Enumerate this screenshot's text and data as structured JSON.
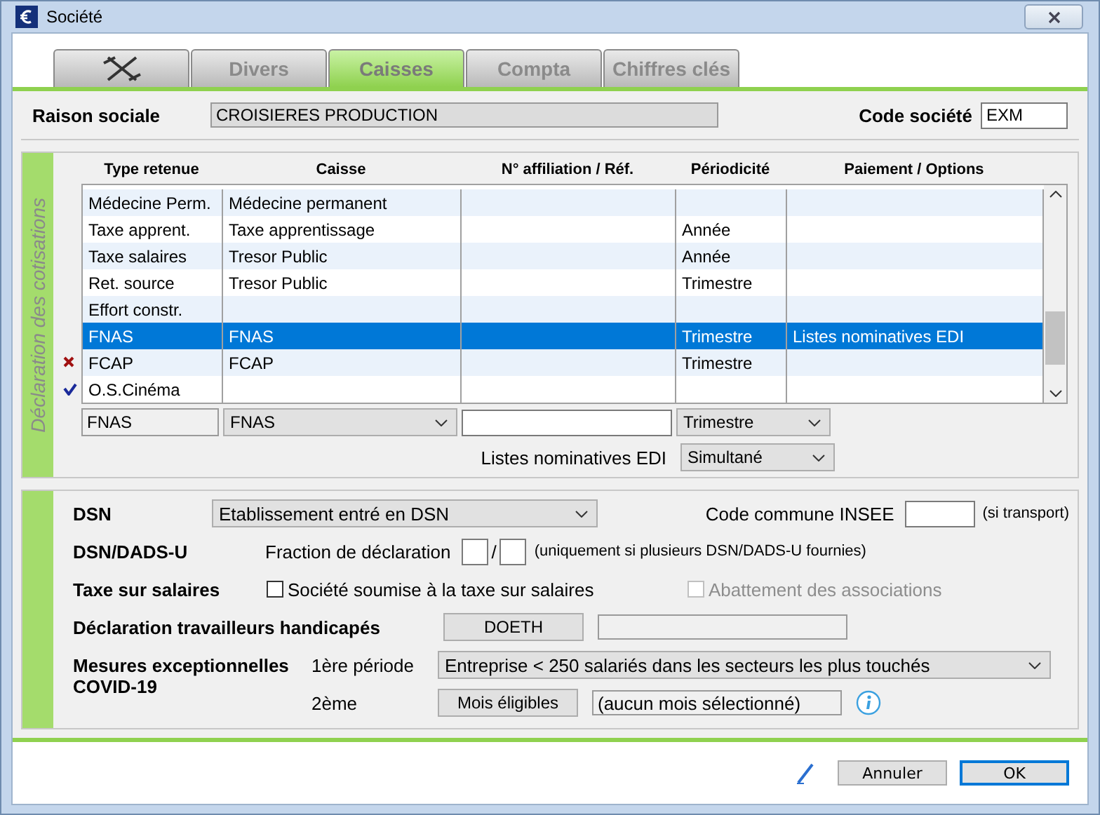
{
  "window": {
    "title": "Société"
  },
  "tabs": [
    {
      "kind": "icon",
      "selected": false
    },
    {
      "kind": "text",
      "label": "Divers",
      "selected": false
    },
    {
      "kind": "text",
      "label": "Caisses",
      "selected": true
    },
    {
      "kind": "text",
      "label": "Compta",
      "selected": false
    },
    {
      "kind": "text",
      "label": "Chiffres clés",
      "selected": false
    }
  ],
  "header": {
    "raison_label": "Raison sociale",
    "raison_value": "CROISIERES PRODUCTION",
    "code_label": "Code société",
    "code_value": "EXM"
  },
  "cotisations": {
    "title": "Déclaration des cotisations",
    "columns": [
      "Type retenue",
      "Caisse",
      "N° affiliation / Réf.",
      "Périodicité",
      "Paiement / Options"
    ],
    "rows": [
      {
        "cells": [
          "Médecine Perm.",
          "Médecine permanent",
          "",
          "",
          ""
        ],
        "selected": false,
        "kind": "plain"
      },
      {
        "cells": [
          "Taxe apprent.",
          "Taxe apprentissage",
          "",
          "Année",
          ""
        ],
        "selected": false,
        "kind": "plain"
      },
      {
        "cells": [
          "Taxe salaires",
          "Tresor Public",
          "",
          "Année",
          ""
        ],
        "selected": false,
        "kind": "plain"
      },
      {
        "cells": [
          "Ret. source",
          "Tresor Public",
          "",
          "Trimestre",
          ""
        ],
        "selected": false,
        "kind": "plain"
      },
      {
        "cells": [
          "Effort constr.",
          "",
          "",
          "",
          ""
        ],
        "selected": false,
        "kind": "plain"
      },
      {
        "cells": [
          "FNAS",
          "FNAS",
          "",
          "Trimestre",
          "Listes nominatives EDI"
        ],
        "selected": true,
        "kind": "plain"
      },
      {
        "cells": [
          "FCAP",
          "FCAP",
          "",
          "Trimestre",
          ""
        ],
        "selected": false,
        "kind": "cross"
      },
      {
        "cells": [
          "O.S.Cinéma",
          "",
          "",
          "",
          ""
        ],
        "selected": false,
        "kind": "check"
      }
    ],
    "editor": {
      "type": "FNAS",
      "caisse": "FNAS",
      "periodicite": "Trimestre",
      "options_label": "Listes nominatives EDI",
      "options_value": "Simultané"
    }
  },
  "declarations": {
    "dsn": {
      "label": "DSN",
      "value": "Etablissement entré en DSN",
      "insee_label": "Code commune INSEE",
      "insee_note": "(si transport)"
    },
    "dads": {
      "label": "DSN/DADS-U",
      "fraction_label": "Fraction de déclaration",
      "separator": "/",
      "note": "(uniquement si plusieurs DSN/DADS-U fournies)"
    },
    "taxe": {
      "label": "Taxe sur salaires",
      "checkboxes": [
        {
          "label": "Société soumise à la taxe sur salaires",
          "checked": false,
          "disabled": false
        },
        {
          "label": "Abattement des associations",
          "checked": false,
          "disabled": true
        }
      ]
    },
    "handicapes": {
      "label": "Déclaration travailleurs handicapés",
      "button": "DOETH"
    },
    "covid": {
      "label": "Mesures exceptionnelles COVID-19",
      "period1_label": "1ère période",
      "period1_value": "Entreprise < 250 salariés dans les secteurs les plus touchés",
      "period2_label": "2ème",
      "period2_button": "Mois éligibles",
      "period2_value": "(aucun mois sélectionné)"
    }
  },
  "buttons": [
    {
      "label": "Annuler",
      "default": false
    },
    {
      "label": "OK",
      "default": true
    }
  ]
}
